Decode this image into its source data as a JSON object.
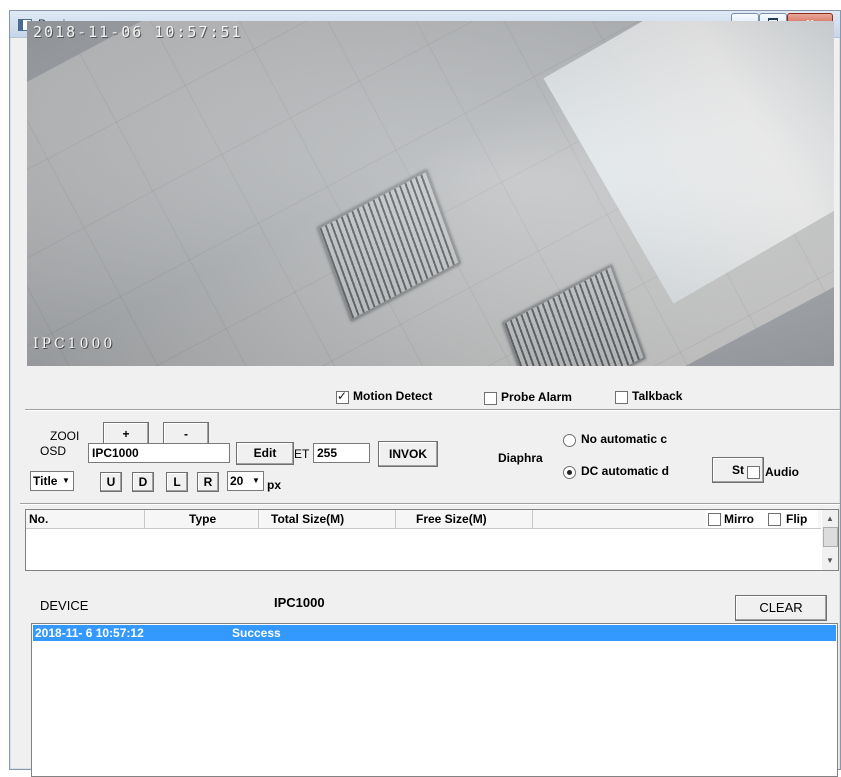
{
  "window": {
    "title": "Preview"
  },
  "video": {
    "timestamp": "2018-11-06  10:57:51",
    "camera_name": "IPC1000"
  },
  "checkbar": {
    "motion_detect": {
      "label": "Motion Detect",
      "checked": true
    },
    "probe_alarm": {
      "label": "Probe Alarm",
      "checked": false
    },
    "talkback": {
      "label": "Talkback",
      "checked": false
    }
  },
  "ptz": {
    "zoom_label": "ZOOI",
    "zoom_plus": "+",
    "zoom_minus": "-",
    "osd_label": "OSD",
    "osd_value": "IPC1000",
    "edit_label": "Edit",
    "preset_label": "ET",
    "preset_value": "255",
    "invoke_label": "INVOK",
    "title_combo": "Title",
    "u": "U",
    "d": "D",
    "l": "L",
    "r": "R",
    "px_combo": "20",
    "px_label": "px"
  },
  "diaphragm": {
    "label": "Diaphra",
    "no_auto": {
      "label": "No automatic c",
      "selected": false
    },
    "dc_auto": {
      "label": "DC automatic d",
      "selected": true
    },
    "set_button": "St",
    "audio": {
      "label": "Audio",
      "checked": false
    }
  },
  "storage_table": {
    "columns": [
      "No.",
      "Type",
      "Total Size(M)",
      "Free Size(M)"
    ],
    "rows": [],
    "mirror": {
      "label": "Mirro",
      "checked": false
    },
    "flip": {
      "label": "Flip",
      "checked": false
    }
  },
  "device": {
    "label": "DEVICE",
    "value": "IPC1000",
    "clear_button": "CLEAR"
  },
  "log": {
    "entries": [
      {
        "time": "2018-11- 6  10:57:12",
        "status": "Success"
      }
    ]
  },
  "icons": [
    "preview-window-icon",
    "minimize-icon",
    "maximize-icon",
    "close-icon",
    "dropdown-arrow-icon",
    "scroll-up-icon",
    "scroll-down-icon"
  ],
  "colors": {
    "selection": "#3399ff",
    "window_bg": "#f0f0f0"
  }
}
